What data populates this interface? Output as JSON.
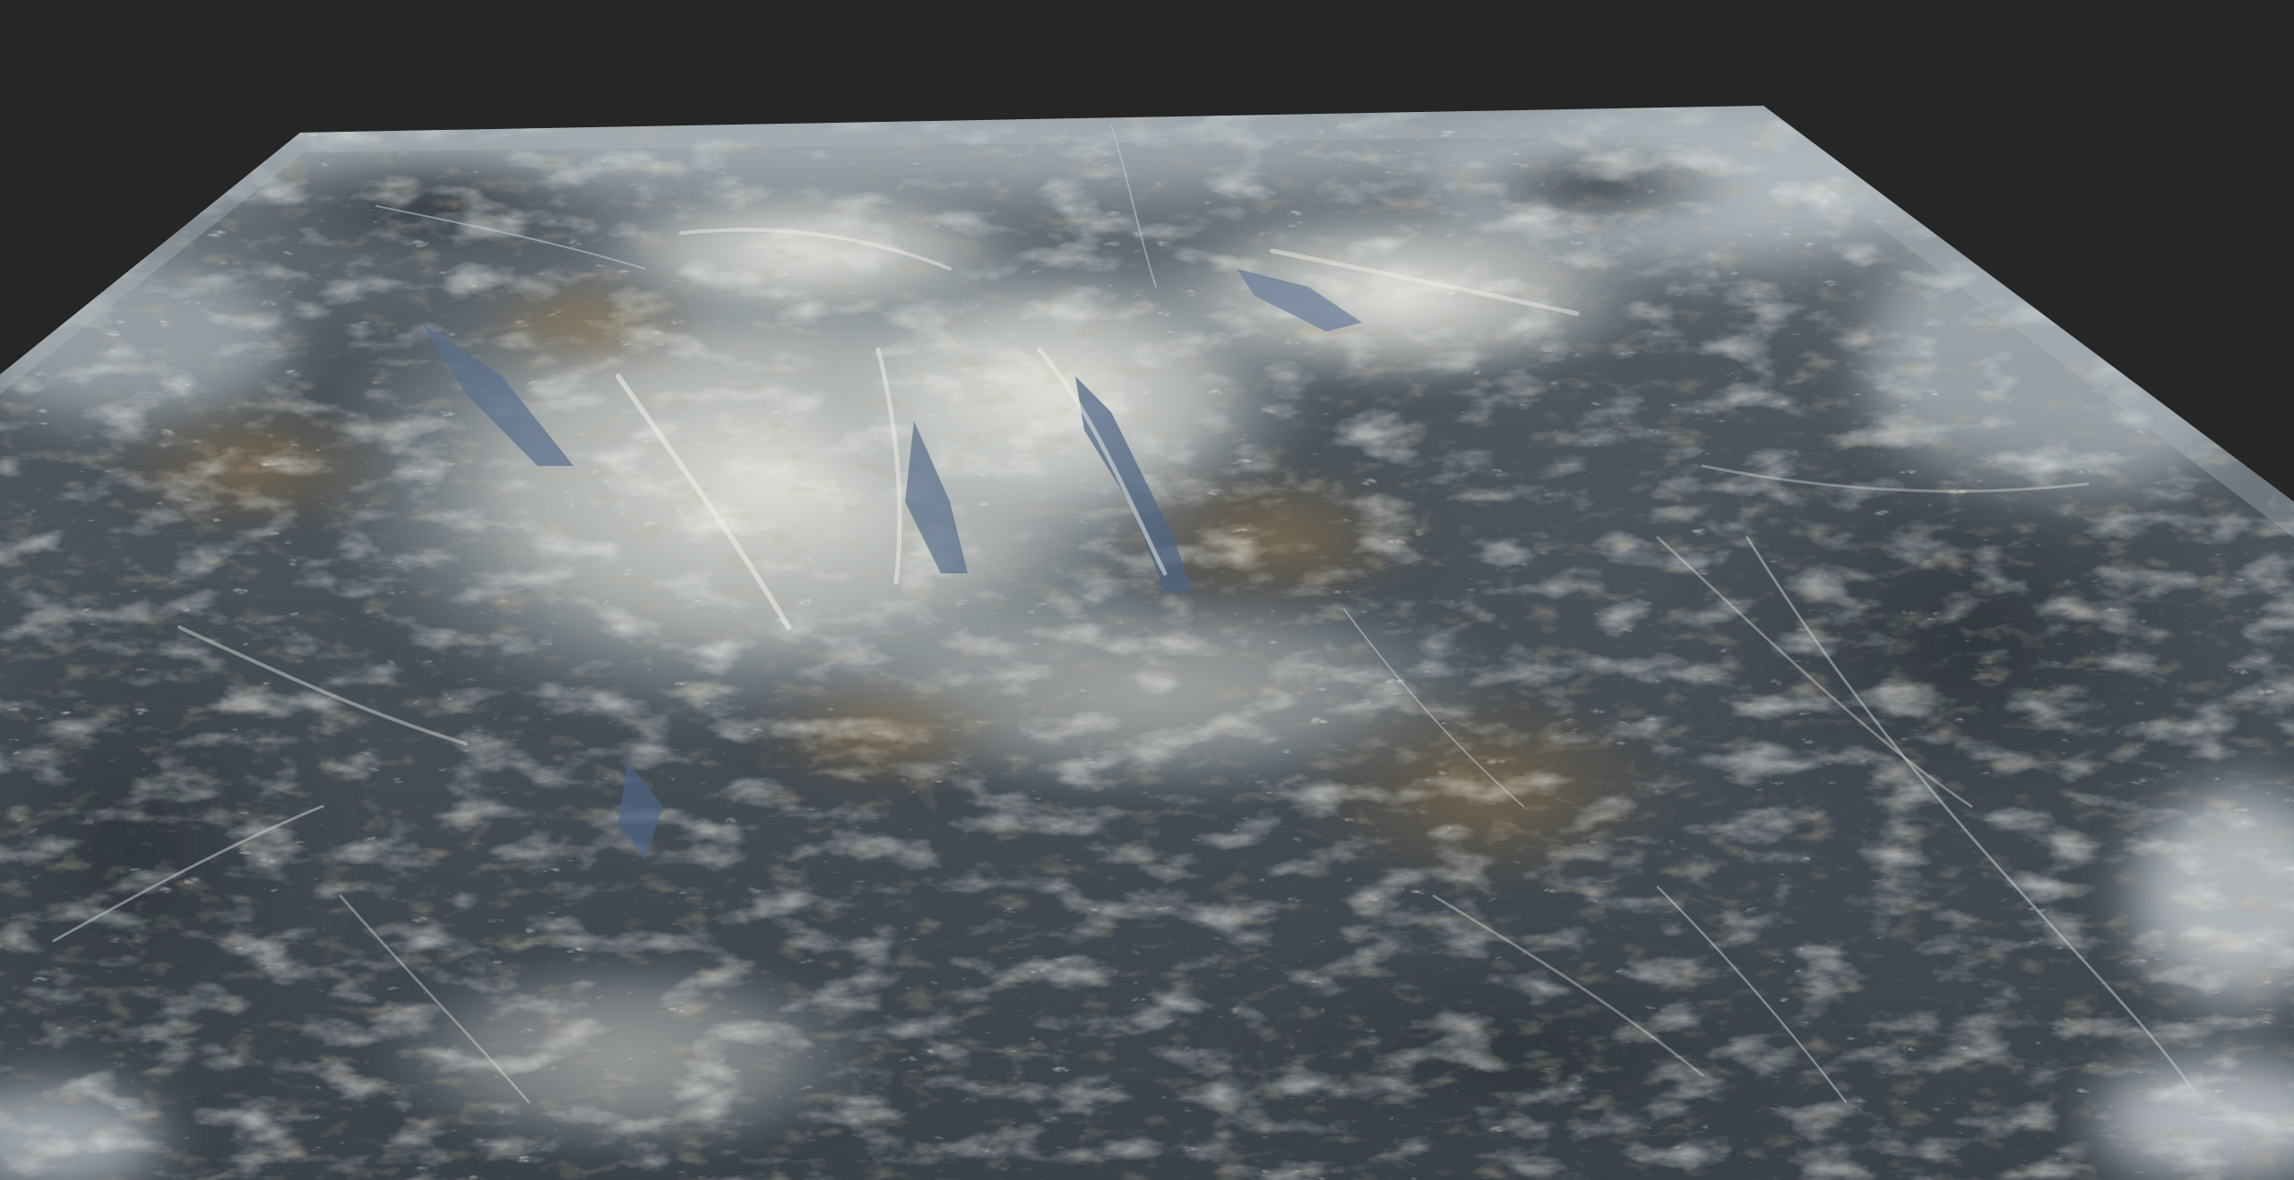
{
  "viewport": {
    "background_color": "#262626"
  },
  "terrain": {
    "palette": {
      "valley_dark": "#3a4148",
      "valley_mid": "#4c545c",
      "rock_blue": "#6f7f93",
      "snow_light": "#d9dcd4",
      "snow_bright": "#ecece4",
      "dirt_brown": "#7d6a4c",
      "edge_fog": "#9aa3aa"
    }
  }
}
